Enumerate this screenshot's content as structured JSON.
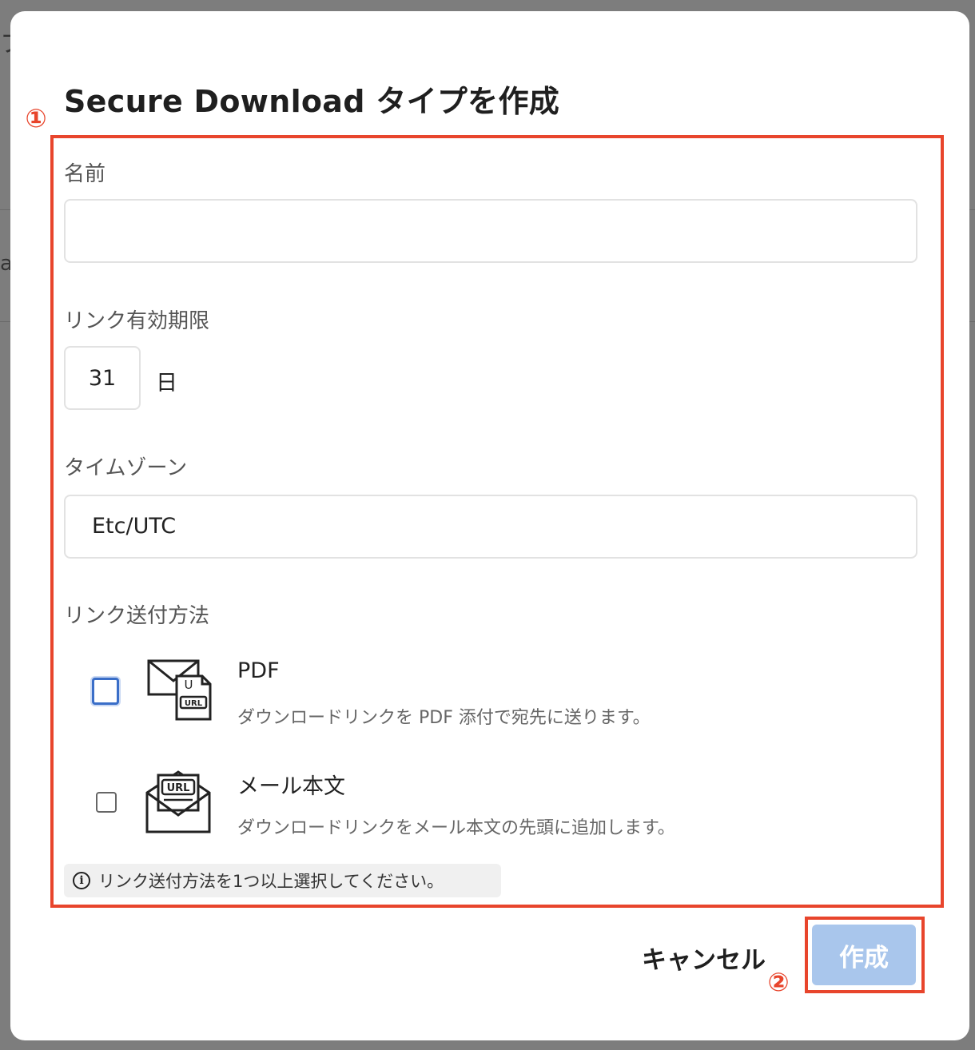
{
  "background_page": {
    "glyph_top": "フ",
    "glyph_mid": "a"
  },
  "dialog": {
    "title": "Secure Download タイプを作成",
    "annotation_1": "①",
    "annotation_2": "②",
    "annotation_color": "#e8452c"
  },
  "form": {
    "name": {
      "label": "名前",
      "value": "",
      "placeholder": ""
    },
    "expiry": {
      "label": "リンク有効期限",
      "value": "31",
      "unit": "日"
    },
    "timezone": {
      "label": "タイムゾーン",
      "value": "Etc/UTC"
    },
    "delivery": {
      "label": "リンク送付方法",
      "options": [
        {
          "title": "PDF",
          "description": "ダウンロードリンクを PDF 添付で宛先に送ります。",
          "checked": false,
          "focused": true,
          "icon": "envelope-pdf-url-icon",
          "icon_text": "URL",
          "icon_text2": "U"
        },
        {
          "title": "メール本文",
          "description": "ダウンロードリンクをメール本文の先頭に追加します。",
          "checked": false,
          "focused": false,
          "icon": "envelope-url-icon",
          "icon_text": "URL"
        }
      ],
      "notice": "リンク送付方法を1つ以上選択してください。",
      "notice_icon": "i"
    }
  },
  "actions": {
    "cancel_label": "キャンセル",
    "create_label": "作成",
    "create_color": "#a9c6ec",
    "create_disabled": true
  }
}
